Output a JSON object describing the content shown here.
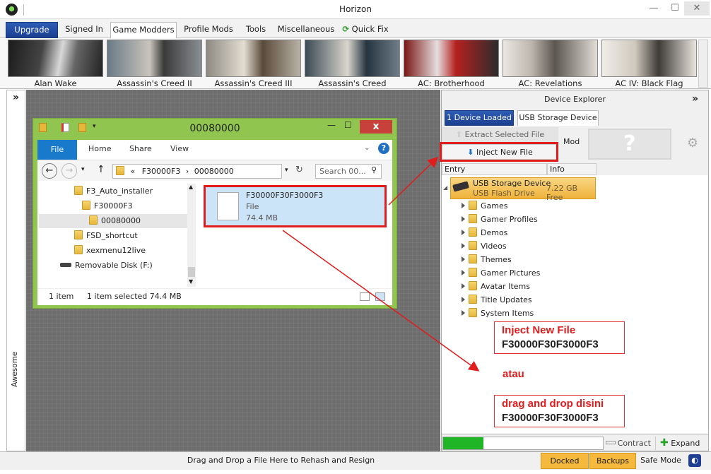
{
  "window": {
    "title": "Horizon",
    "minimize": "—",
    "maximize": "☐",
    "close": "✕"
  },
  "menu": {
    "items": [
      "Upgrade",
      "Signed In",
      "Game Modders",
      "Profile Mods",
      "Tools",
      "Miscellaneous",
      "Quick Fix"
    ],
    "active": "Game Modders"
  },
  "games": [
    "Alan Wake",
    "Assassin's Creed II",
    "Assassin's Creed III",
    "Assassin's Creed Rogue",
    "AC: Brotherhood",
    "AC: Revelations",
    "AC IV: Black Flag"
  ],
  "sidebar": {
    "label": "Awesome",
    "collapse": "»"
  },
  "explorer": {
    "title": "00080000",
    "close": "x",
    "ribbon_tabs": [
      "File",
      "Home",
      "Share",
      "View"
    ],
    "address": {
      "prefix": "«",
      "path1": "F30000F3",
      "sep": "›",
      "path2": "00080000"
    },
    "search_placeholder": "Search 00...",
    "nav_items": [
      "F3_Auto_installer",
      "F30000F3",
      "00080000",
      "FSD_shortcut",
      "xexmenu12live",
      "Removable Disk (F:)"
    ],
    "file": {
      "name": "F30000F30F3000F3",
      "type": "File",
      "size": "74.4 MB"
    },
    "status": {
      "count": "1 item",
      "selected": "1 item selected  74.4 MB"
    }
  },
  "device_explorer": {
    "header": "Device Explorer",
    "collapse": "»",
    "tabs": [
      "1 Device Loaded",
      "USB Storage Device"
    ],
    "extract": "Extract Selected File",
    "inject": "Inject New File",
    "mod": "Mod",
    "unknown": "?",
    "columns": [
      "Entry",
      "Info"
    ],
    "device": {
      "name": "USB Storage Device",
      "type": "USB Flash Drive",
      "free": "7.22 GB Free"
    },
    "folders": [
      "Games",
      "Gamer Profiles",
      "Demos",
      "Videos",
      "Themes",
      "Gamer Pictures",
      "Avatar Items",
      "Title Updates",
      "System Items"
    ],
    "progress": 0.25,
    "contract": "Contract",
    "expand": "Expand"
  },
  "annotations": {
    "box1_line1": "Inject New File",
    "box1_line2": "F30000F30F3000F3",
    "atau": "atau",
    "box2_line1": "drag and drop disini",
    "box2_line2": "F30000F30F3000F3"
  },
  "bottom": {
    "message": "Drag and Drop a File Here to Rehash and Resign",
    "docked": "Docked",
    "backups": "Backups",
    "safe_mode": "Safe Mode"
  },
  "colors": {
    "accent": "#1c3f90",
    "annotation": "#e01c1c",
    "explorer_frame": "#90c650",
    "highlight": "#f5b93e"
  }
}
